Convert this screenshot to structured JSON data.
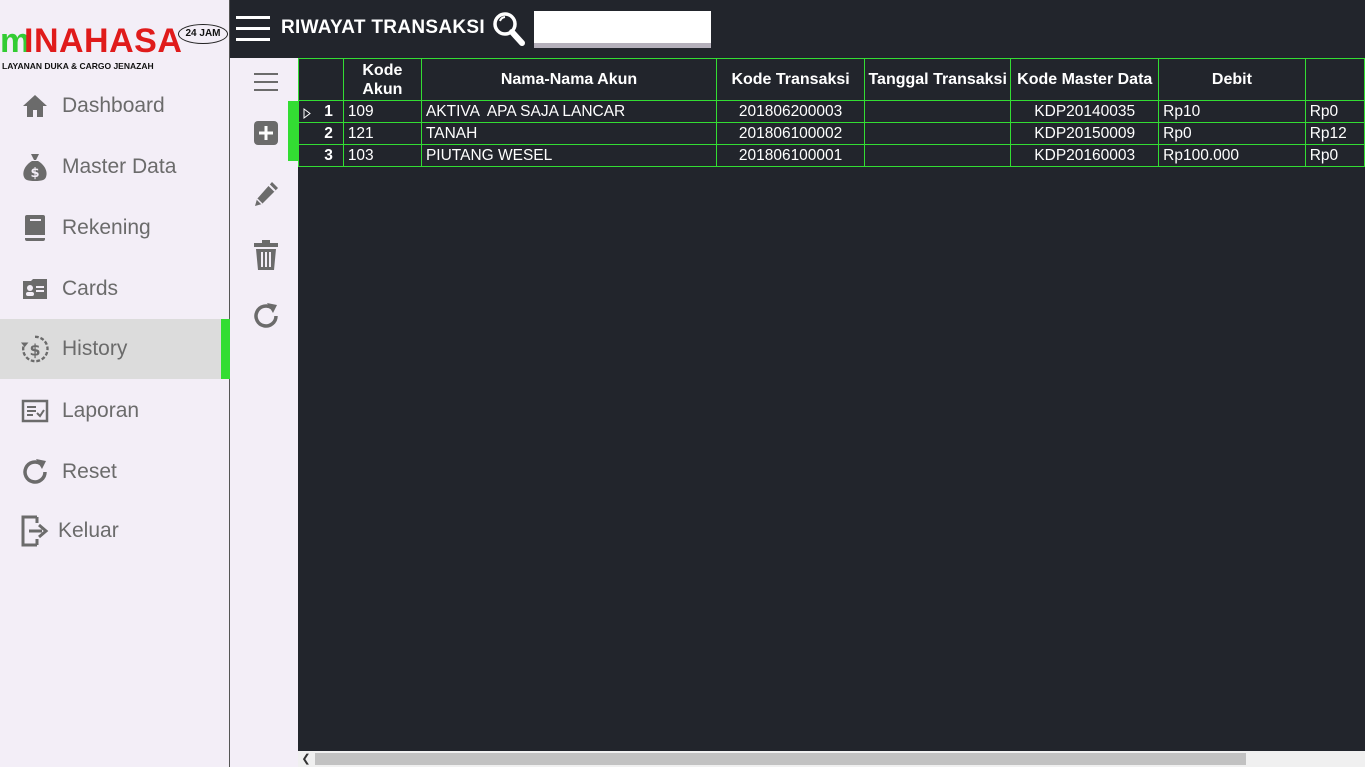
{
  "brand": {
    "logo_m": "m",
    "logo_rest": "INAHASA",
    "badge": "24 JAM",
    "subtitle": "LAYANAN DUKA & CARGO JENAZAH"
  },
  "sidebar": {
    "items": [
      {
        "label": "Dashboard",
        "icon": "home-icon"
      },
      {
        "label": "Master Data",
        "icon": "money-bag-icon"
      },
      {
        "label": "Rekening",
        "icon": "book-icon"
      },
      {
        "label": "Cards",
        "icon": "id-card-icon"
      },
      {
        "label": "History",
        "icon": "history-money-icon",
        "active": true
      },
      {
        "label": "Laporan",
        "icon": "report-icon"
      },
      {
        "label": "Reset",
        "icon": "reset-icon"
      },
      {
        "label": "Keluar",
        "icon": "logout-icon"
      }
    ]
  },
  "topbar": {
    "title": "RIWAYAT TRANSAKSI",
    "search_value": ""
  },
  "toolbar": [
    "menu-icon",
    "add-icon",
    "edit-icon",
    "delete-icon",
    "refresh-icon"
  ],
  "grid": {
    "columns": [
      "Kode Akun",
      "Nama-Nama Akun",
      "Kode Transaksi",
      "Tanggal Transaksi",
      "Kode Master Data",
      "Debit",
      ""
    ],
    "rows": [
      {
        "num": "1",
        "kode_akun": "109",
        "nama": "AKTIVA  APA SAJA LANCAR",
        "kode_transaksi": "201806200003",
        "tanggal": "",
        "kode_master": "KDP20140035",
        "debit": "Rp10",
        "kredit": "Rp0"
      },
      {
        "num": "2",
        "kode_akun": "121",
        "nama": "TANAH",
        "kode_transaksi": "201806100002",
        "tanggal": "",
        "kode_master": "KDP20150009",
        "debit": "Rp0",
        "kredit": "Rp12"
      },
      {
        "num": "3",
        "kode_akun": "103",
        "nama": "PIUTANG WESEL",
        "kode_transaksi": "201806100001",
        "tanggal": "",
        "kode_master": "KDP20160003",
        "debit": "Rp100.000",
        "kredit": "Rp0"
      }
    ]
  },
  "colors": {
    "accent": "#33dd33",
    "dark_bg": "#22252c",
    "sidebar_bg": "#f3eef7",
    "logo_red": "#e01b1b",
    "logo_green": "#33cc33"
  }
}
